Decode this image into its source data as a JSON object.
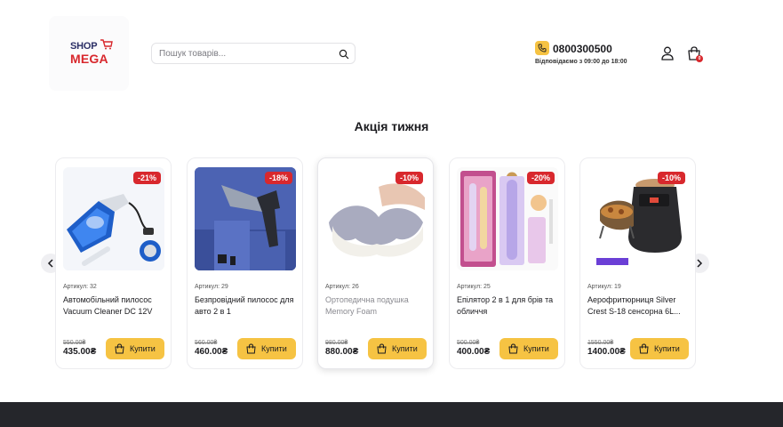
{
  "header": {
    "logo_top": "SHOP",
    "logo_bottom": "MEGA",
    "search_placeholder": "Пошук товарів...",
    "phone": "0800300500",
    "hours": "Відповідаємо з 09:00 до 18:00",
    "cart_count": "0"
  },
  "colors": {
    "accent": "#f6c343",
    "brand_red": "#d8282d",
    "brand_navy": "#2b2f66",
    "footer": "#25262b"
  },
  "section": {
    "title": "Акція тижня"
  },
  "products": [
    {
      "discount": "-21%",
      "article": "Артикул: 32",
      "name": "Автомобільний пилосос Vacuum Cleaner DC 12V",
      "old_price": "550.00₴",
      "price": "435.00₴",
      "buy": "Купити"
    },
    {
      "discount": "-18%",
      "article": "Артикул: 29",
      "name": "Безпровідний пилосос для авто 2 в 1",
      "old_price": "560.00₴",
      "price": "460.00₴",
      "buy": "Купити"
    },
    {
      "discount": "-10%",
      "article": "Артикул: 26",
      "name": "Ортопедична подушка Memory Foam",
      "old_price": "980.00₴",
      "price": "880.00₴",
      "buy": "Купити"
    },
    {
      "discount": "-20%",
      "article": "Артикул: 25",
      "name": "Епілятор 2 в 1 для брів та обличчя",
      "old_price": "500.00₴",
      "price": "400.00₴",
      "buy": "Купити"
    },
    {
      "discount": "-10%",
      "article": "Артикул: 19",
      "name": "Аерофритюрниця Silver Crest S-18 сенсорна 6L...",
      "old_price": "1550.00₴",
      "price": "1400.00₴",
      "buy": "Купити"
    }
  ]
}
